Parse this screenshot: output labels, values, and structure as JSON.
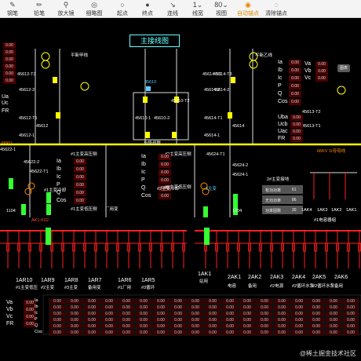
{
  "toolbar": {
    "items": [
      {
        "icon": "pen-icon",
        "glyph": "✎",
        "label": "钢笔"
      },
      {
        "icon": "pencil-icon",
        "glyph": "✏",
        "label": "铅笔"
      },
      {
        "icon": "magnifier-icon",
        "glyph": "⚲",
        "label": "放大镜"
      },
      {
        "icon": "thumbnail-icon",
        "glyph": "◎",
        "label": "细略图"
      },
      {
        "icon": "start-point-icon",
        "glyph": "○",
        "label": "起点"
      },
      {
        "icon": "end-point-icon",
        "glyph": "●",
        "label": "终点"
      },
      {
        "icon": "connect-icon",
        "glyph": "↘",
        "label": "连线"
      },
      {
        "icon": "line-width-icon",
        "glyph": "1⌄",
        "label": "线宽"
      },
      {
        "icon": "view-icon",
        "glyph": "80⌄",
        "label": "视图"
      },
      {
        "icon": "auto-anchor-icon",
        "glyph": "◉",
        "label": "自动锚点",
        "active": true
      },
      {
        "icon": "delete-anchor-icon",
        "glyph": "◌",
        "label": "清除锚点"
      }
    ]
  },
  "diagram": {
    "title": "主接线图",
    "top_left_values": [
      "0.00",
      "0.00",
      "0.00",
      "0.00",
      "0.00",
      "0.00"
    ],
    "top_left_labels": [
      "45612-T3",
      "45612-2",
      "45612-T1",
      "45612",
      "45612-1",
      "Ua",
      "Uc",
      "FR"
    ],
    "left_side_labels": [
      "45622-1",
      "45622-2",
      "45622-T1",
      "1104",
      "AK1-K02"
    ],
    "mid_labels": [
      "45610",
      "45610-T2",
      "45610-1",
      "45610-2",
      "分段母联",
      "45624-T1",
      "45624-2",
      "45624-1",
      "45614-T3",
      "45614-2",
      "45614-T1",
      "45614-1",
      "45614",
      "1204"
    ],
    "right_top_labels": [
      "45614-T3",
      "45614-2",
      "45613-T2",
      "45613-T1",
      "0.00"
    ],
    "plant_names": [
      "平新甲线",
      "平新乙线"
    ],
    "bus_left_label": "66KV",
    "bus_right_label": "66KV 1I母母线",
    "meter_right_top": {
      "keys": [
        "Va",
        "Vb",
        "Vc"
      ],
      "values": [
        "0.00",
        "0.00",
        "0.00"
      ],
      "button": "图表"
    },
    "meter_right_mid": {
      "keys": [
        "Uba",
        "Ucb",
        "Uac",
        "FR"
      ],
      "values": [
        "0.00",
        "0.00",
        "0.00",
        "0.00"
      ]
    },
    "meter_center_top": {
      "keys": [
        "Ia",
        "Ib",
        "Ic",
        "P",
        "Q",
        "Cos"
      ],
      "values": [
        "0.00",
        "0.00",
        "0.00",
        "0.00",
        "0.00",
        "0.00"
      ]
    },
    "meter_mid_left": {
      "header": "#1主变高压侧",
      "keys": [
        "Ia",
        "Ib",
        "Ic",
        "P",
        "Q",
        "Cos"
      ],
      "values": [
        "0.00",
        "0.00",
        "0.00",
        "0.00",
        "0.00",
        "0.00"
      ],
      "sub": "#1主变低压侧"
    },
    "meter_mid_center": {
      "header": "#2主变高压侧",
      "keys": [
        "Ia",
        "Ib",
        "Ic",
        "P",
        "Q",
        "Cos"
      ],
      "values": [
        "0.00",
        "0.00",
        "0.00",
        "0.00",
        "0.00",
        "0.00"
      ],
      "sub": "#2主变低压侧"
    },
    "meter_mid_right": {
      "keys": [
        "Ia",
        "Ib",
        "Ic",
        "P",
        "Q",
        "Cos"
      ],
      "values": [
        "0.00",
        "0.00",
        "0.00",
        "0.00",
        "0.00",
        "0.00"
      ]
    },
    "popup": {
      "rows": [
        {
          "label": "有功功率",
          "value": "61"
        },
        {
          "label": "无功功率",
          "value": "86"
        },
        {
          "label": "功率因数",
          "value": "30"
        }
      ]
    },
    "right_bay_labels": [
      "1AK4",
      "1AK3",
      "1AK2",
      "1AK1",
      "#1电容器组"
    ],
    "feeder_left": [
      {
        "code": "1AR10",
        "name": "#1主变低压"
      },
      {
        "code": "1AR9",
        "name": "#2主变"
      },
      {
        "code": "1AR8",
        "name": "#3主变"
      },
      {
        "code": "1AR7",
        "name": "备用变"
      },
      {
        "code": "1AR6",
        "name": "#1厂用"
      },
      {
        "code": "1AR5",
        "name": "#3循环"
      }
    ],
    "feeder_mid": {
      "code": "1AK1",
      "name": "站用"
    },
    "feeder_right": [
      {
        "code": "2AK1",
        "name": "电容"
      },
      {
        "code": "2AK2",
        "name": "备用"
      },
      {
        "code": "2AK3",
        "name": "#2电源"
      },
      {
        "code": "2AK4",
        "name": "#2循环水泵"
      },
      {
        "code": "2AK5",
        "name": "#2循环水泵"
      },
      {
        "code": "2AK6",
        "name": "备用"
      }
    ],
    "bottom_left_meter": {
      "keys": [
        "Va",
        "Vb",
        "Vc",
        "FR"
      ],
      "values": [
        "0.00",
        "0.00",
        "0.00",
        "0.00"
      ]
    },
    "bottom_grid": {
      "keys": [
        "Ia",
        "Ib",
        "Ic",
        "P",
        "Q",
        "Cos"
      ],
      "value": "0.00"
    },
    "small_labels": [
      "#1主变冷却",
      "#2主变冷却",
      "2主变",
      "厂用变",
      "2#主变接地"
    ]
  },
  "watermark": "@稀土掘金技术社区",
  "colors": {
    "bus_yellow": "#ffff00",
    "bus_red": "#ff2020",
    "accent_cyan": "#55ccff",
    "meter_bg": "#4a0000",
    "breaker_green": "#33ff33",
    "toolbar_active": "#e08a00"
  }
}
